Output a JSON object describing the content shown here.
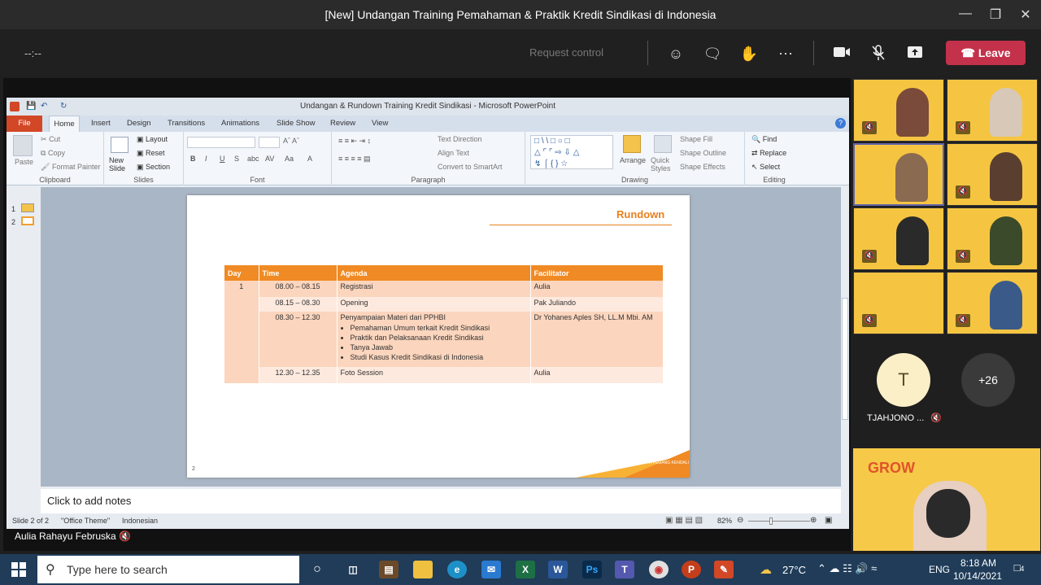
{
  "window": {
    "title": "[New] Undangan Training Pemahaman & Praktik Kredit Sindikasi di Indonesia"
  },
  "meeting_toolbar": {
    "timer": "--:--",
    "request_control": "Request control",
    "leave_label": "Leave"
  },
  "powerpoint": {
    "title": "Undangan & Rundown Training Kredit Sindikasi - Microsoft PowerPoint",
    "tabs": [
      "File",
      "Home",
      "Insert",
      "Design",
      "Transitions",
      "Animations",
      "Slide Show",
      "Review",
      "View"
    ],
    "clipboard": {
      "paste": "Paste",
      "cut": "Cut",
      "copy": "Copy",
      "format_painter": "Format Painter",
      "label": "Clipboard"
    },
    "slides_group": {
      "new_slide": "New Slide",
      "layout": "Layout",
      "reset": "Reset",
      "section": "Section",
      "label": "Slides"
    },
    "font_group": {
      "label": "Font"
    },
    "paragraph_group": {
      "text_direction": "Text Direction",
      "align_text": "Align Text",
      "convert": "Convert to SmartArt",
      "label": "Paragraph"
    },
    "drawing_group": {
      "arrange": "Arrange",
      "quick_styles": "Quick Styles",
      "shape_fill": "Shape Fill",
      "shape_outline": "Shape Outline",
      "shape_effects": "Shape Effects",
      "label": "Drawing"
    },
    "editing_group": {
      "find": "Find",
      "replace": "Replace",
      "select": "Select",
      "label": "Editing"
    },
    "thumbs": [
      "1",
      "2"
    ],
    "notes_placeholder": "Click to add notes",
    "status": {
      "slide": "Slide 2 of 2",
      "theme": "\"Office Theme\"",
      "language": "Indonesian",
      "zoom": "82%"
    }
  },
  "slide": {
    "heading": "Rundown",
    "page_number": "2",
    "footer_text": "SAATNYA PEGANG KENDALI",
    "headers": [
      "Day",
      "Time",
      "Agenda",
      "Facilitator"
    ],
    "rows": [
      {
        "day": "1",
        "time": "08.00 – 08.15",
        "agenda": "Registrasi",
        "facilitator": "Aulia"
      },
      {
        "day": "",
        "time": "08.15 – 08.30",
        "agenda": "Opening",
        "facilitator": "Pak Juliando"
      },
      {
        "day": "",
        "time": "08.30 – 12.30",
        "agenda": "Penyampaian Materi dari PPHBI",
        "facilitator": "Dr Yohanes Aples SH, LL.M Mbi. AM",
        "subitems": [
          "Pemahaman Umum terkait Kredit Sindikasi",
          "Praktik dan Pelaksanaan Kredit Sindikasi",
          "Tanya Jawab",
          "Studi Kasus Kredit Sindikasi di Indonesia"
        ]
      },
      {
        "day": "",
        "time": "12.30 – 12.35",
        "agenda": "Foto Session",
        "facilitator": "Aulia"
      }
    ]
  },
  "presenter": {
    "name": "Aulia Rahayu Februska"
  },
  "participants": {
    "avatar_initial": "T",
    "avatar_name": "TJAHJONO ...",
    "more_count": "+26",
    "banner_word": "GROW"
  },
  "taskbar": {
    "search_placeholder": "Type here to search",
    "weather": "27°C",
    "lang": "ENG",
    "time": "8:18 AM",
    "date": "10/14/2021",
    "notif_count": "4"
  }
}
